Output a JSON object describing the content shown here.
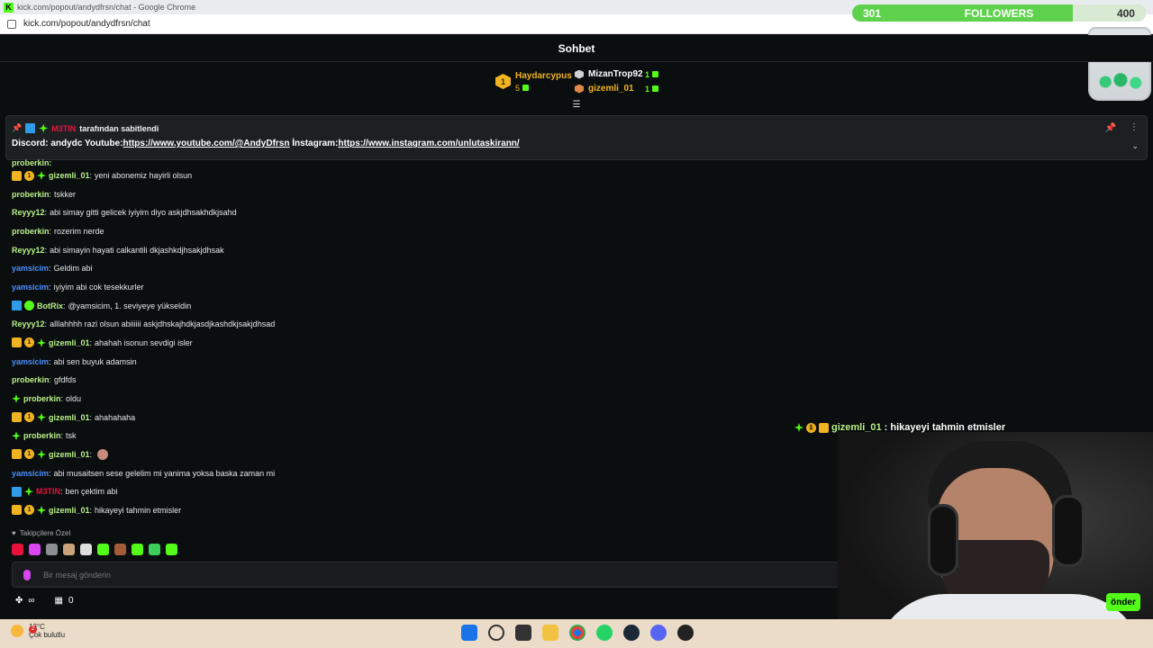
{
  "browser": {
    "window_title": "kick.com/popout/andydfrsn/chat - Google Chrome",
    "url": "kick.com/popout/andydfrsn/chat"
  },
  "goal": {
    "current": "301",
    "label": "FOLLOWERS",
    "target": "400",
    "progress_fraction": 0.75
  },
  "chat": {
    "title": "Sohbet",
    "leaderboard": {
      "first": {
        "rank": "1",
        "name": "Haydarcypus",
        "count": "5"
      },
      "others": [
        {
          "name": "MizanTrop92",
          "count": "1"
        },
        {
          "name": "gizemli_01",
          "count": "1"
        }
      ]
    },
    "pinned": {
      "user": "M3TIN",
      "by_text": "tarafından sabitlendi",
      "text_prefix": "Discord: andydc Youtube:",
      "youtube_link": "https://www.youtube.com/@AndyDfrsn",
      "instagram_label": " İnstagram:",
      "instagram_link": "https://www.instagram.com/unlutaskirann/"
    },
    "cutoff_user": "proberkin:",
    "messages": [
      {
        "user": "gizemli_01",
        "color": "#b9f28a",
        "badges": [
          "crown",
          "one",
          "vip"
        ],
        "text": "yeni abonemiz hayirli olsun"
      },
      {
        "user": "proberkin",
        "color": "#b9f28a",
        "badges": [],
        "text": "tskker"
      },
      {
        "user": "Reyyy12",
        "color": "#b9f28a",
        "badges": [],
        "text": "abi simay gitti gelicek iyiyim diyo askjdhsakhdkjsahd"
      },
      {
        "user": "proberkin",
        "color": "#b9f28a",
        "badges": [],
        "text": "rozerim nerde"
      },
      {
        "user": "Reyyy12",
        "color": "#b9f28a",
        "badges": [],
        "text": "abi simayin hayati calkantili dkjashkdjhsakjdhsak"
      },
      {
        "user": "yamsicim",
        "color": "#4a8fff",
        "badges": [],
        "text": "Geldim abi"
      },
      {
        "user": "yamsicim",
        "color": "#4a8fff",
        "badges": [],
        "text": "iyiyim abi cok tesekkurler"
      },
      {
        "user": "BotRix",
        "color": "#b9f28a",
        "badges": [
          "mod",
          "bot"
        ],
        "text": "@yamsicim, 1. seviyeye yükseldin"
      },
      {
        "user": "Reyyy12",
        "color": "#b9f28a",
        "badges": [],
        "text": "alllahhhh razi olsun abiiiiii askjdhskajhdkjasdjkashdkjsakjdhsad"
      },
      {
        "user": "gizemli_01",
        "color": "#b9f28a",
        "badges": [
          "crown",
          "one",
          "vip"
        ],
        "text": "ahahah isonun sevdigi isler"
      },
      {
        "user": "yamsicim",
        "color": "#4a8fff",
        "badges": [],
        "text": "abi sen buyuk adamsin"
      },
      {
        "user": "proberkin",
        "color": "#b9f28a",
        "badges": [],
        "text": "gfdfds"
      },
      {
        "user": "proberkin",
        "color": "#b9f28a",
        "badges": [
          "vip"
        ],
        "text": "oldu"
      },
      {
        "user": "gizemli_01",
        "color": "#b9f28a",
        "badges": [
          "crown",
          "one",
          "vip"
        ],
        "text": "ahahahaha"
      },
      {
        "user": "proberkin",
        "color": "#b9f28a",
        "badges": [
          "vip"
        ],
        "text": "tsk"
      },
      {
        "user": "gizemli_01",
        "color": "#b9f28a",
        "badges": [
          "crown",
          "one",
          "vip"
        ],
        "text": ""
      },
      {
        "user": "yamsicim",
        "color": "#4a8fff",
        "badges": [],
        "text": "abi musaitsen sese gelelim mi yanima yoksa baska zaman mi"
      },
      {
        "user": "M3TIN",
        "color": "#e9113c",
        "badges": [
          "mod",
          "vip"
        ],
        "text": "ben çektim abi"
      },
      {
        "user": "gizemli_01",
        "color": "#b9f28a",
        "badges": [
          "crown",
          "one",
          "vip"
        ],
        "text": "hikayeyi tahmin etmisler"
      }
    ],
    "followers_only": "Takipçilere Özel",
    "input_placeholder": "Bir mesaj gönderin",
    "bottom_count": "0",
    "infinity": "∞",
    "send_label": "önder"
  },
  "overlay": {
    "user": "gizemli_01",
    "text": ": hikayeyi tahmin etmisler"
  },
  "taskbar": {
    "temperature": "13°C",
    "weather": "Çok bulutlu",
    "alert_count": "2"
  }
}
